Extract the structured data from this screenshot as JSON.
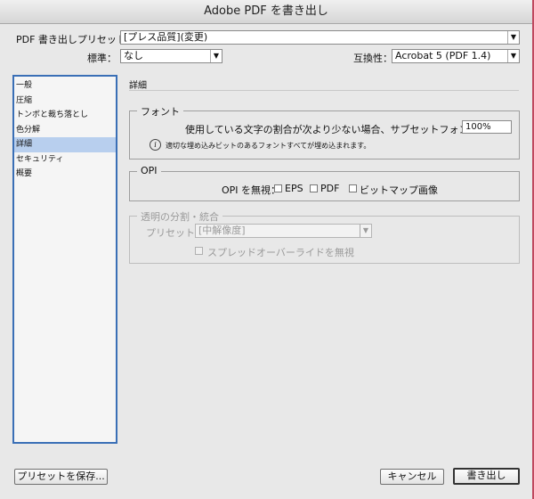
{
  "window": {
    "title": "Adobe PDF を書き出し"
  },
  "header": {
    "preset_label": "PDF 書き出しプリセット：",
    "preset_value": "[プレス品質](変更)",
    "standard_label": "標準：",
    "standard_value": "なし",
    "compat_label": "互換性：",
    "compat_value": "Acrobat 5 (PDF 1.4)"
  },
  "sidebar": {
    "items": [
      {
        "label": "一般"
      },
      {
        "label": "圧縮"
      },
      {
        "label": "トンボと裁ち落とし"
      },
      {
        "label": "色分解"
      },
      {
        "label": "詳細"
      },
      {
        "label": "セキュリティ"
      },
      {
        "label": "概要"
      }
    ],
    "selected_index": 4
  },
  "main": {
    "section_title": "詳細",
    "font_group": {
      "legend": "フォント",
      "subset_label": "使用している文字の割合が次より少ない場合、サブセットフォントにする：",
      "subset_value": "100%",
      "info_text": "適切な埋め込みビットのあるフォントすべてが埋め込まれます。"
    },
    "opi_group": {
      "legend": "OPI",
      "omit_label": "OPI を無視：",
      "eps_label": "EPS",
      "pdf_label": "PDF",
      "bitmap_label": "ビットマップ画像"
    },
    "transparency_group": {
      "legend": "透明の分割・統合",
      "preset_label": "プリセット：",
      "preset_value": "[中解像度]",
      "override_label": "スプレッドオーバーライドを無視"
    }
  },
  "footer": {
    "save_preset": "プリセットを保存...",
    "cancel": "キャンセル",
    "export": "書き出し"
  }
}
